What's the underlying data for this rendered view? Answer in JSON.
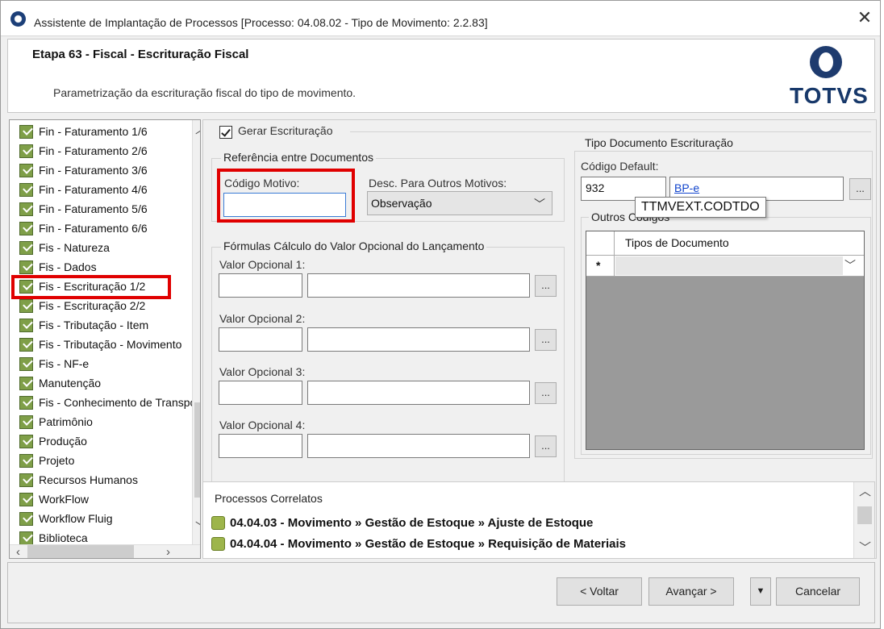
{
  "window": {
    "title": "Assistente de Implantação de Processos [Processo: 04.08.02 - Tipo de Movimento: 2.2.83]",
    "close_label": "✕"
  },
  "header": {
    "step_title": "Etapa 63 - Fiscal - Escrituração Fiscal",
    "description": "Parametrização da escrituração fiscal do tipo de movimento.",
    "logo_text": "TOTVS"
  },
  "nav": {
    "items": [
      {
        "label": "Fin - Faturamento 1/6"
      },
      {
        "label": "Fin - Faturamento 2/6"
      },
      {
        "label": "Fin - Faturamento 3/6"
      },
      {
        "label": "Fin - Faturamento 4/6"
      },
      {
        "label": "Fin - Faturamento 5/6"
      },
      {
        "label": "Fin - Faturamento 6/6"
      },
      {
        "label": "Fis - Natureza"
      },
      {
        "label": "Fis - Dados"
      },
      {
        "label": "Fis - Escrituração 1/2"
      },
      {
        "label": "Fis - Escrituração 2/2"
      },
      {
        "label": "Fis - Tributação - Item"
      },
      {
        "label": "Fis - Tributação - Movimento"
      },
      {
        "label": "Fis - NF-e"
      },
      {
        "label": "Manutenção"
      },
      {
        "label": "Fis - Conhecimento de Transporte"
      },
      {
        "label": "Patrimônio"
      },
      {
        "label": "Produção"
      },
      {
        "label": "Projeto"
      },
      {
        "label": "Recursos Humanos"
      },
      {
        "label": "WorkFlow"
      },
      {
        "label": "Workflow Fluig"
      },
      {
        "label": "Biblioteca"
      }
    ]
  },
  "form": {
    "gerar_label": "Gerar Escrituração",
    "referencia_title": "Referência entre Documentos",
    "codigo_motivo_label": "Código Motivo:",
    "codigo_motivo_value": "",
    "desc_outros_label": "Desc. Para Outros Motivos:",
    "desc_outros_value": "Observação",
    "formulas_title": "Fórmulas Cálculo do Valor Opcional do Lançamento",
    "valor_labels": [
      "Valor Opcional 1:",
      "Valor Opcional 2:",
      "Valor Opcional 3:",
      "Valor Opcional 4:"
    ],
    "tipo_doc_title": "Tipo Documento Escrituração",
    "codigo_default_label": "Código Default:",
    "codigo_default_value": "932",
    "codigo_default_desc": "BP-e",
    "tooltip": "TTMVEXT.CODTDO",
    "outros_codigos_title": "Outros Códigos",
    "grid_header": "Tipos de Documento",
    "grid_row_marker": "*",
    "lookup_label": "..."
  },
  "processos": {
    "title": "Processos Correlatos",
    "items": [
      "04.04.03 - Movimento » Gestão de Estoque » Ajuste de Estoque",
      "04.04.04 - Movimento » Gestão de Estoque » Requisição de Materiais"
    ]
  },
  "footer": {
    "voltar": "< Voltar",
    "avancar": "Avançar >",
    "cancelar": "Cancelar"
  },
  "colors": {
    "highlight": "#e00000",
    "brand": "#17386a",
    "check": "#7f9f48"
  }
}
